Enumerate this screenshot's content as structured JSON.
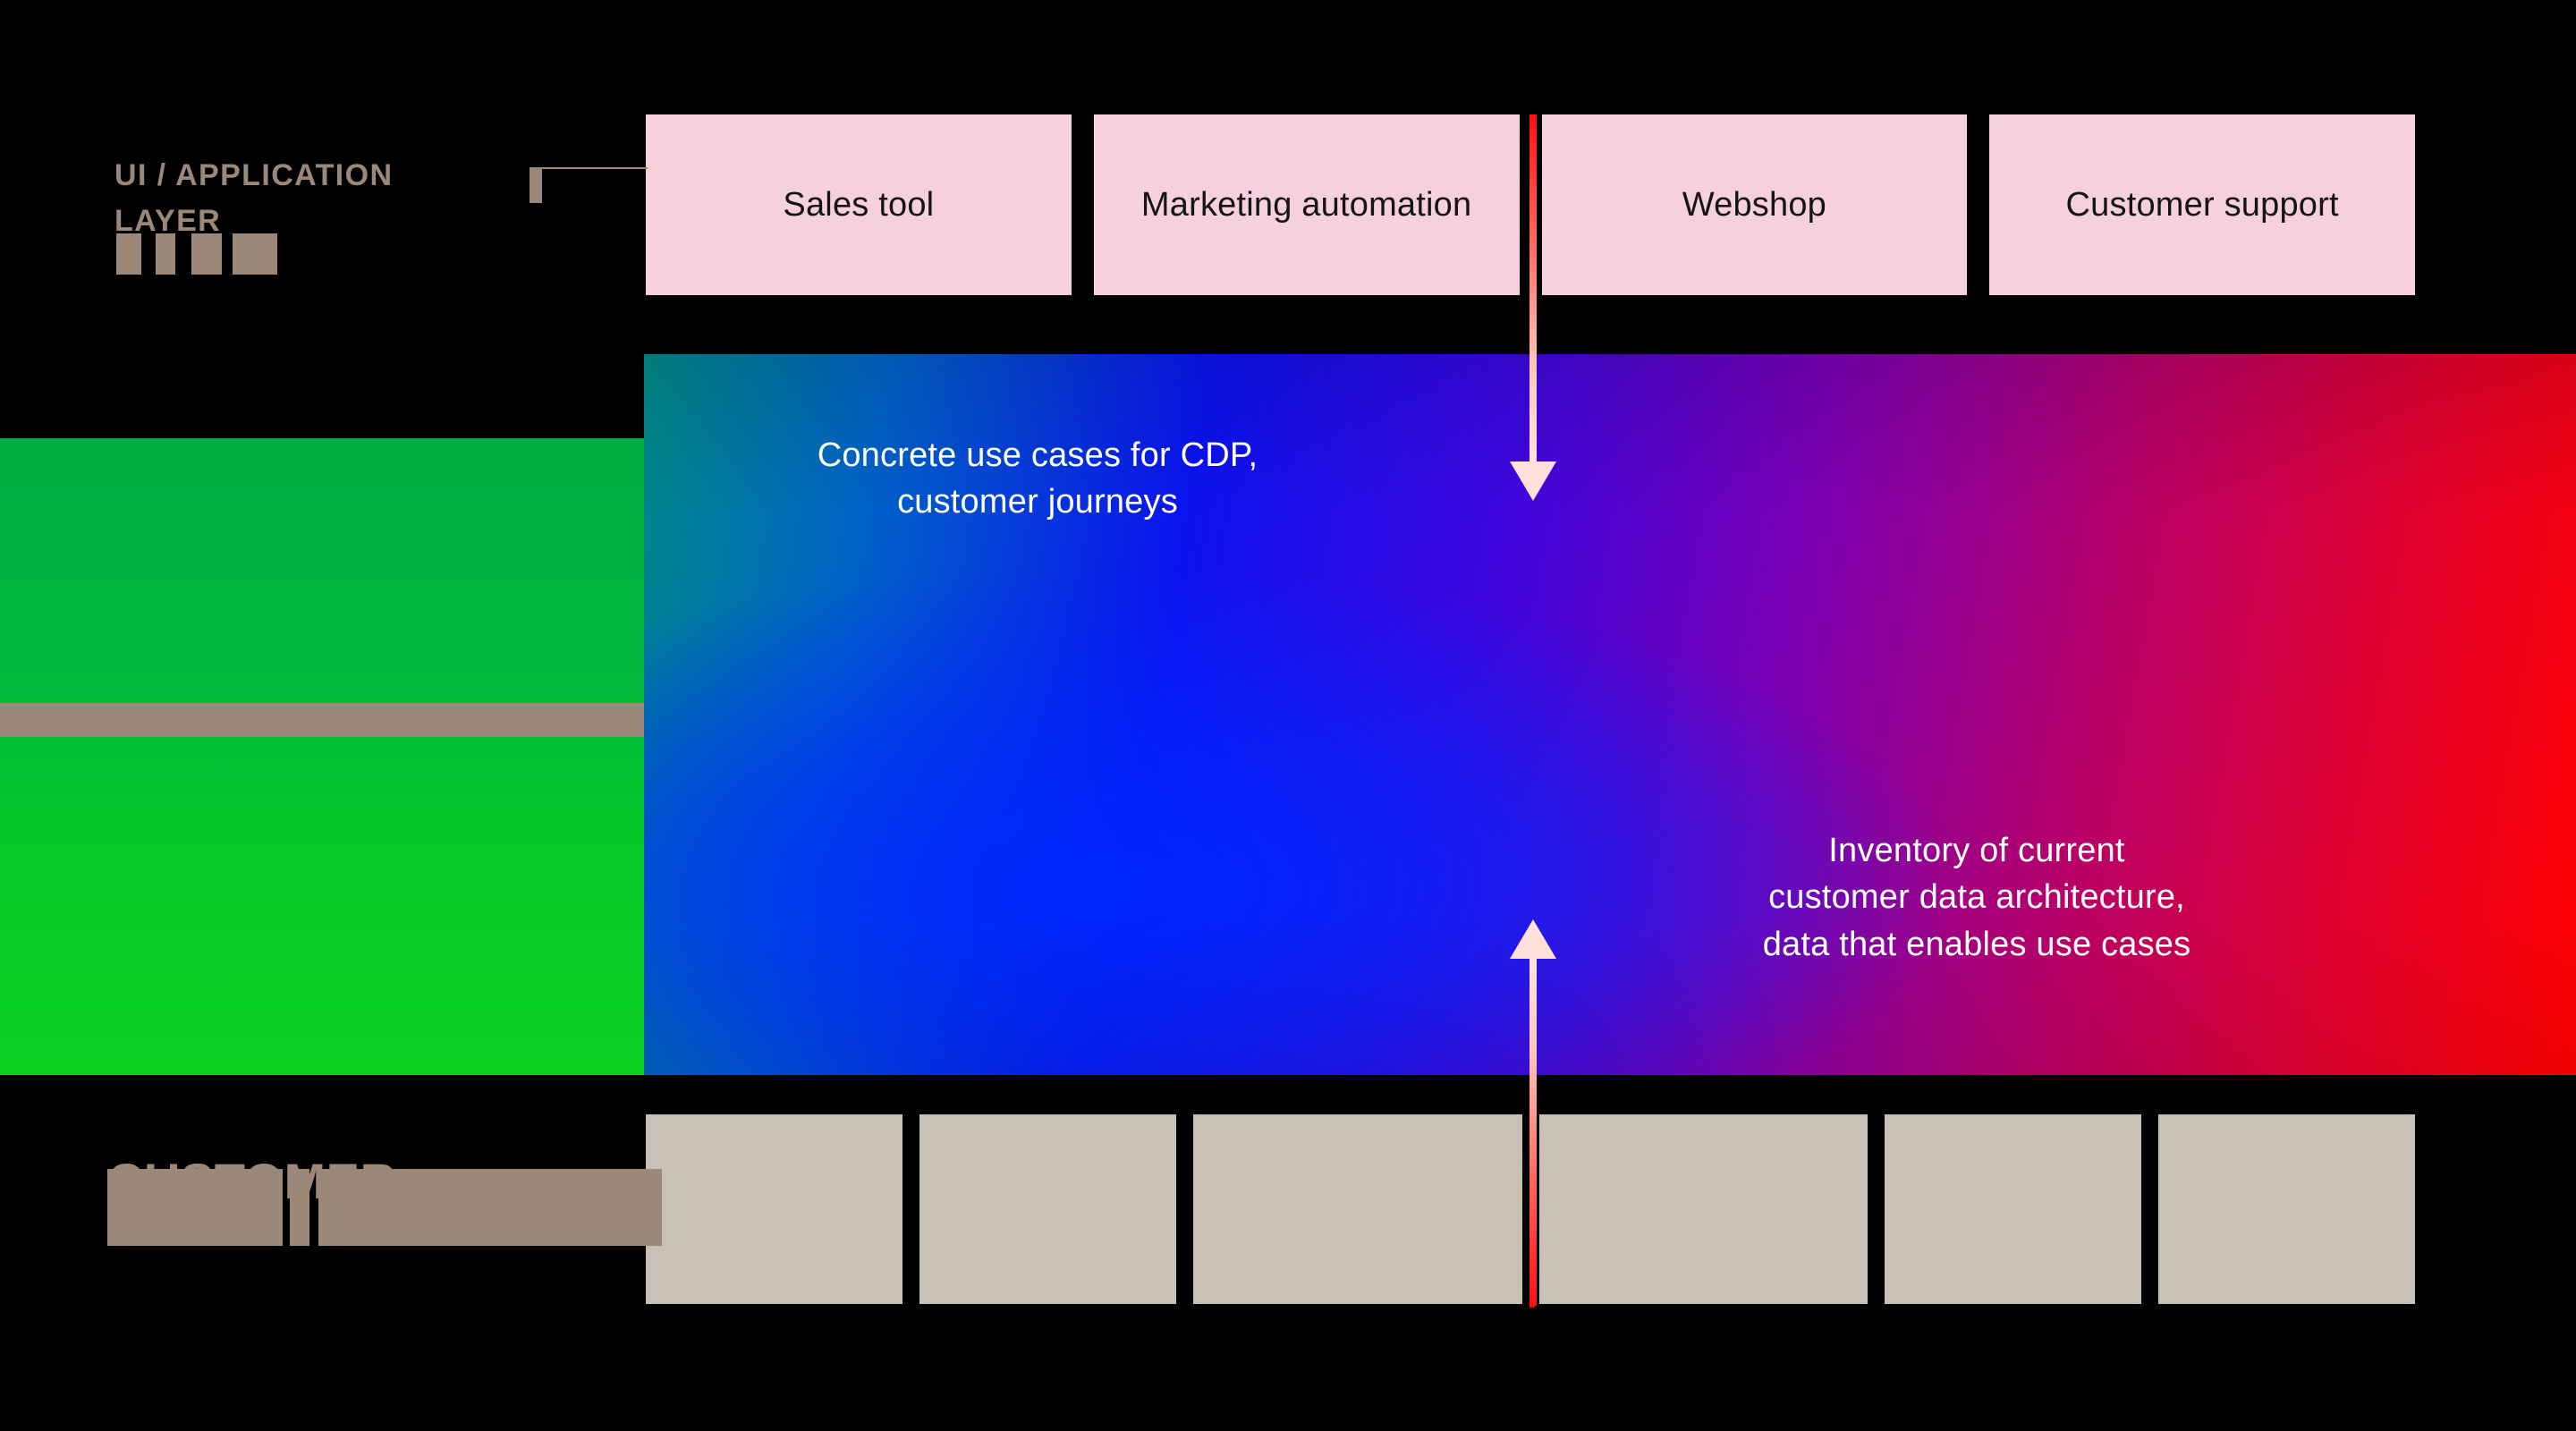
{
  "diagram": {
    "title_hidden": "",
    "layers": {
      "application": {
        "label_line1": "UI / APPLICATION",
        "label_line2": "LAYER",
        "boxes": [
          {
            "label": "Sales tool"
          },
          {
            "label": "Marketing\nautomation"
          },
          {
            "label": "Webshop"
          },
          {
            "label": "Customer\nsupport"
          }
        ]
      },
      "cdp": {
        "annotation_top": "Concrete use cases for CDP,\ncustomer journeys",
        "annotation_bottom": "Inventory of current\ncustomer data architecture,\ndata that enables use cases"
      },
      "data": {
        "label_line1": "CUSTOMER",
        "label_line2": "DATA",
        "boxes": [
          {
            "label": ""
          },
          {
            "label": ""
          },
          {
            "label": ""
          },
          {
            "label": ""
          },
          {
            "label": ""
          },
          {
            "label": ""
          }
        ]
      }
    },
    "arrows": [
      {
        "name": "down-arrow",
        "direction": "down"
      },
      {
        "name": "up-arrow",
        "direction": "up"
      }
    ],
    "colors": {
      "background": "#000000",
      "app_box": "#f6d0da",
      "source_box": "#c9c0b6",
      "label_tan": "#9c8878",
      "gradient_green": "#00d021",
      "gradient_blue": "#0b12ef",
      "gradient_red": "#ff0000",
      "arrow_red": "#ff1010",
      "annotation_text": "#ffffff"
    }
  }
}
